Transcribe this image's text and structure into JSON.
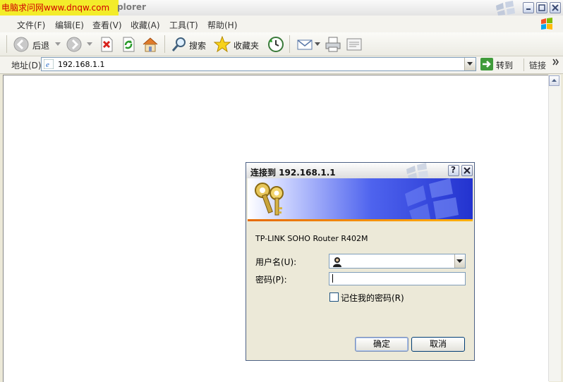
{
  "watermark": "电脑求问网www.dnqw.com",
  "window": {
    "title_fragment": "plorer"
  },
  "menu": [
    "文件(F)",
    "编辑(E)",
    "查看(V)",
    "收藏(A)",
    "工具(T)",
    "帮助(H)"
  ],
  "toolbar": {
    "back_label": "后退",
    "search_label": "搜索",
    "favorites_label": "收藏夹"
  },
  "address": {
    "label": "地址(D)",
    "value": "192.168.1.1",
    "go_label": "转到",
    "links_label": "链接"
  },
  "dialog": {
    "title": "连接到 192.168.1.1",
    "device": "TP-LINK SOHO Router R402M",
    "username_label": "用户名(U):",
    "password_label": "密码(P):",
    "remember_label": "记住我的密码(R)",
    "ok_label": "确定",
    "cancel_label": "取消",
    "help_glyph": "?"
  },
  "icons": {
    "accent": "#2333cf",
    "banner_line": "#e66a00"
  }
}
